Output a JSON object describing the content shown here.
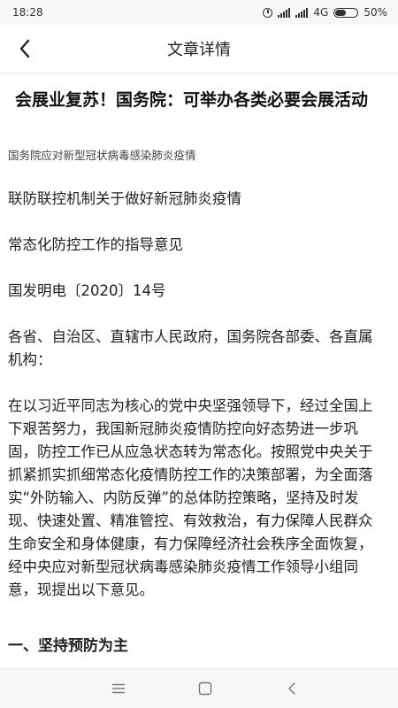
{
  "status_bar": {
    "time": "18:28",
    "network": "4G",
    "battery_percent": "50%",
    "battery_level": 0.5
  },
  "header": {
    "title": "文章详情"
  },
  "article": {
    "title": "会展业复苏！国务院：可举办各类必要会展活动",
    "source": "国务院应对新型冠状病毒感染肺炎疫情",
    "paragraphs": [
      "联防联控机制关于做好新冠肺炎疫情",
      "常态化防控工作的指导意见",
      "国发明电〔2020〕14号",
      "各省、自治区、直辖市人民政府，国务院各部委、各直属机构：",
      "在以习近平同志为核心的党中央坚强领导下，经过全国上下艰苦努力，我国新冠肺炎疫情防控向好态势进一步巩固，防控工作已从应急状态转为常态化。按照党中央关于抓紧抓实抓细常态化疫情防控工作的决策部署，为全面落实“外防输入、内防反弹”的总体防控策略，坚持及时发现、快速处置、精准管控、有效救治，有力保障人民群众生命安全和身体健康，有力保障经济社会秩序全面恢复，经中央应对新型冠状病毒感染肺炎疫情工作领导小组同意，现提出以下意见。"
    ],
    "section_heading": "一、坚持预防为主"
  },
  "icons": {
    "back": "back-arrow-icon",
    "menu": "menu-icon",
    "home": "home-icon",
    "nav_back": "nav-back-icon"
  }
}
